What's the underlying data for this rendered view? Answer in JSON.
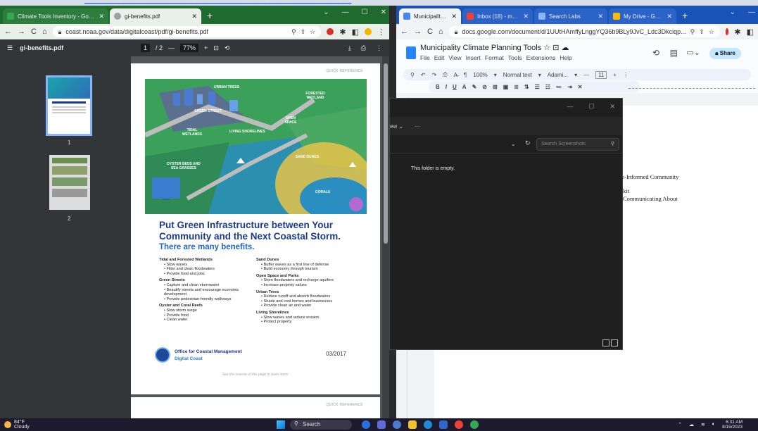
{
  "top_link": "climate tools inventory link",
  "left_window": {
    "tabs": [
      {
        "label": "Climate Tools Inventory - Google",
        "color": "#34a853"
      },
      {
        "label": "gi-benefits.pdf",
        "color": "#9aa0a6"
      }
    ],
    "url": "coast.noaa.gov/data/digitalcoast/pdf/gi-benefits.pdf",
    "pdf_toolbar": {
      "filename": "gi-benefits.pdf",
      "page_current": "1",
      "page_total": "/ 2",
      "zoom": "77%"
    },
    "thumbnails": [
      {
        "num": "1"
      },
      {
        "num": "2"
      }
    ],
    "page": {
      "quick_ref": "QUICK REFERENCE",
      "illustration_labels": {
        "urban_trees": "URBAN TREES",
        "forested_wetland": "FORESTED WETLAND",
        "green_street": "GREEN STREET",
        "tidal_wetlands": "TIDAL WETLANDS",
        "living_shorelines": "LIVING SHORELINES",
        "open_space": "OPEN SPACE",
        "sand_dunes": "SAND DUNES",
        "oyster_beds": "OYSTER BEDS AND SEA GRASSES",
        "corals": "CORALS"
      },
      "headline": "Put Green Infrastructure between Your Community and the Next Coastal Storm.",
      "subhead": "There are many benefits.",
      "col1": [
        {
          "heading": "Tidal and Forested Wetlands",
          "items": [
            "Slow waves",
            "Filter and clean floodwaters",
            "Provide food and jobs"
          ]
        },
        {
          "heading": "Green Streets",
          "items": [
            "Capture and clean stormwater",
            "Beautify streets and encourage economic development",
            "Provide pedestrian-friendly walkways"
          ]
        },
        {
          "heading": "Oyster and Coral Reefs",
          "items": [
            "Slow storm surge",
            "Provide food",
            "Clean water"
          ]
        }
      ],
      "col2": [
        {
          "heading": "Sand Dunes",
          "items": [
            "Buffer waves as a first line of defense",
            "Build economy through tourism"
          ]
        },
        {
          "heading": "Open Space and Parks",
          "items": [
            "Store floodwaters and recharge aquifers",
            "Increase property values"
          ]
        },
        {
          "heading": "Urban Trees",
          "items": [
            "Reduce runoff and absorb floodwaters",
            "Shade and cool homes and businesses",
            "Provide clean air and water"
          ]
        },
        {
          "heading": "Living Shorelines",
          "items": [
            "Slow waves and reduce erosion",
            "Protect property"
          ]
        }
      ],
      "org_line1": "Office for Coastal Management",
      "org_line2": "Digital Coast",
      "date": "03/2017",
      "reverse_note": "See the reverse of this page to learn more.",
      "page2_quick_ref": "QUICK REFERENCE"
    }
  },
  "right_window": {
    "tabs": [
      {
        "label": "Municipality Climat",
        "color": "#4285f4"
      },
      {
        "label": "Inbox (18) - manas",
        "color": "#ea4335"
      },
      {
        "label": "Search Labs",
        "color": "#4285f4"
      },
      {
        "label": "My Drive - Google",
        "color": "#fbbc04"
      }
    ],
    "url": "docs.google.com/document/d/1UUtHAmffyLnggYQ36b9BLy9JvC_Ldc3Dkciqp...",
    "doc_title": "Municipality Climate Planning Tools",
    "menu": [
      "File",
      "Edit",
      "View",
      "Insert",
      "Format",
      "Tools",
      "Extensions",
      "Help"
    ],
    "share_label": "Share",
    "zoom": "100%",
    "style": "Normal text",
    "font": "Adami...",
    "font_size": "11",
    "doc_lines": [
      "te-Informed Community",
      "kit",
      "Communicating About"
    ]
  },
  "explorer": {
    "cmd_view": "ew",
    "cmd_more": "···",
    "search_placeholder": "Search Screenshots",
    "empty_text": "This folder is empty."
  },
  "taskbar": {
    "temp": "84°F",
    "condition": "Cloudy",
    "search_label": "Search",
    "time": "6:31 AM",
    "date": "8/15/2023"
  }
}
